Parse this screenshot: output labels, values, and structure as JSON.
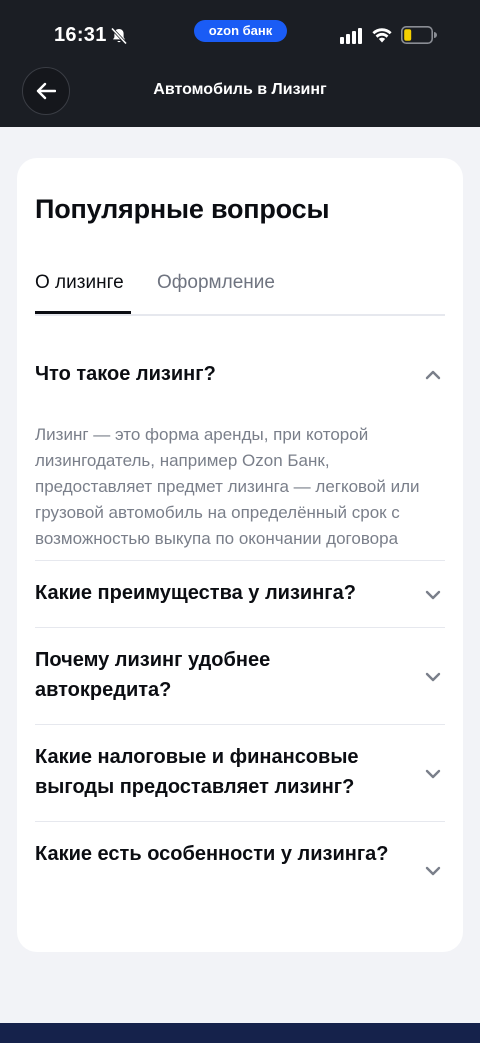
{
  "status_bar": {
    "time": "16:31",
    "brand_pill": "ozon банк"
  },
  "header": {
    "title": "Автомобиль в Лизинг"
  },
  "card": {
    "title": "Популярные вопросы",
    "tabs": [
      {
        "label": "О лизинге",
        "active": true
      },
      {
        "label": "Оформление",
        "active": false
      }
    ],
    "faq": [
      {
        "question": "Что такое лизинг?",
        "expanded": true,
        "answer": "Лизинг — это форма аренды, при которой лизингодатель, например Ozon Банк, предоставляет предмет лизинга — легковой или грузовой автомобиль на определённый срок с возможностью выкупа по окончании договора"
      },
      {
        "question": "Какие преимущества у лизинга?",
        "expanded": false
      },
      {
        "question": "Почему лизинг удобнее автокредита?",
        "expanded": false
      },
      {
        "question": "Какие налоговые и финансовые выгоды предоставляет лизинг?",
        "expanded": false
      },
      {
        "question": "Какие есть особенности у лизинга?",
        "expanded": false
      }
    ]
  },
  "colors": {
    "header_bg": "#1b1e24",
    "brand_blue": "#1a5cf5",
    "page_bg": "#f2f3f7",
    "text_primary": "#0b0d12",
    "text_secondary": "#7a7f8a"
  }
}
